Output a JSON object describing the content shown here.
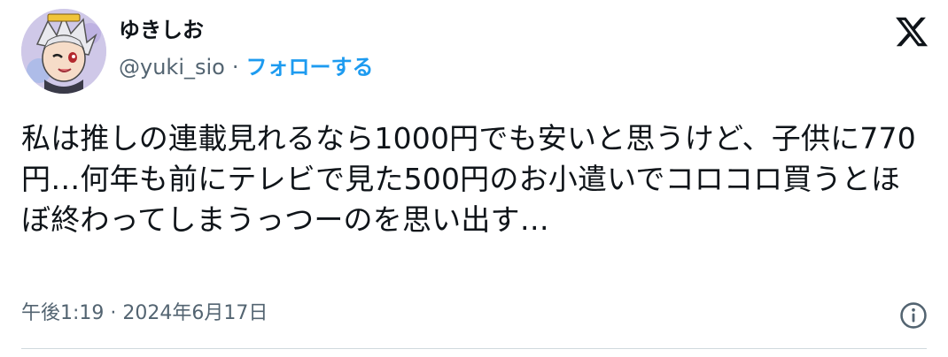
{
  "author": {
    "display_name": "ゆきしお",
    "handle": "@yuki_sio",
    "separator": "·",
    "follow_label": "フォローする",
    "avatar_icon": "user-avatar-icon"
  },
  "brand": {
    "logo_icon": "x-logo-icon",
    "link_color": "#1d9bf0",
    "text_color": "#0f1419",
    "muted_color": "#536471"
  },
  "tweet": {
    "text": "私は推しの連載見れるなら1000円でも安いと思うけど、子供に770円…何年も前にテレビで見た500円のお小遣いでコロコロ買うとほぼ終わってしまうっつーのを思い出す…",
    "timestamp": "午後1:19 · 2024年6月17日"
  },
  "actions": {
    "info_icon": "info-icon"
  }
}
